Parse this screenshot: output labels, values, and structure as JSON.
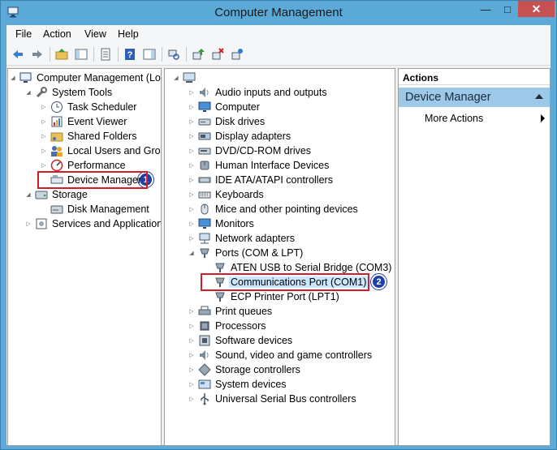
{
  "window": {
    "title": "Computer Management"
  },
  "menu": [
    "File",
    "Action",
    "View",
    "Help"
  ],
  "toolbar": [
    "back-icon",
    "forward-icon",
    "up-folder-icon",
    "show-hide-tree-icon",
    "export-list-icon",
    "help-icon",
    "show-hide-action-pane-icon",
    "scan-hardware-icon",
    "update-driver-icon",
    "uninstall-device-icon",
    "disable-device-icon"
  ],
  "left_tree": [
    {
      "label": "Computer Management (Local",
      "icon": "computer-management-icon",
      "indent": 0,
      "twisty": "expanded"
    },
    {
      "label": "System Tools",
      "icon": "tools-icon",
      "indent": 1,
      "twisty": "expanded"
    },
    {
      "label": "Task Scheduler",
      "icon": "clock-icon",
      "indent": 2,
      "twisty": "collapsed"
    },
    {
      "label": "Event Viewer",
      "icon": "event-viewer-icon",
      "indent": 2,
      "twisty": "collapsed"
    },
    {
      "label": "Shared Folders",
      "icon": "shared-folder-icon",
      "indent": 2,
      "twisty": "collapsed"
    },
    {
      "label": "Local Users and Groups",
      "icon": "users-icon",
      "indent": 2,
      "twisty": "collapsed"
    },
    {
      "label": "Performance",
      "icon": "performance-icon",
      "indent": 2,
      "twisty": "collapsed"
    },
    {
      "label": "Device Manager",
      "icon": "device-manager-icon",
      "indent": 2,
      "twisty": "none"
    },
    {
      "label": "Storage",
      "icon": "storage-icon",
      "indent": 1,
      "twisty": "expanded"
    },
    {
      "label": "Disk Management",
      "icon": "disk-icon",
      "indent": 2,
      "twisty": "none"
    },
    {
      "label": "Services and Applications",
      "icon": "services-icon",
      "indent": 1,
      "twisty": "collapsed"
    }
  ],
  "mid_root": {
    "label": "",
    "icon": "computer-icon"
  },
  "device_tree": [
    {
      "label": "Audio inputs and outputs",
      "icon": "speaker-icon",
      "indent": 1,
      "twisty": "collapsed"
    },
    {
      "label": "Computer",
      "icon": "monitor-icon",
      "indent": 1,
      "twisty": "collapsed"
    },
    {
      "label": "Disk drives",
      "icon": "disk-drive-icon",
      "indent": 1,
      "twisty": "collapsed"
    },
    {
      "label": "Display adapters",
      "icon": "display-adapter-icon",
      "indent": 1,
      "twisty": "collapsed"
    },
    {
      "label": "DVD/CD-ROM drives",
      "icon": "dvd-icon",
      "indent": 1,
      "twisty": "collapsed"
    },
    {
      "label": "Human Interface Devices",
      "icon": "hid-icon",
      "indent": 1,
      "twisty": "collapsed"
    },
    {
      "label": "IDE ATA/ATAPI controllers",
      "icon": "ide-icon",
      "indent": 1,
      "twisty": "collapsed"
    },
    {
      "label": "Keyboards",
      "icon": "keyboard-icon",
      "indent": 1,
      "twisty": "collapsed"
    },
    {
      "label": "Mice and other pointing devices",
      "icon": "mouse-icon",
      "indent": 1,
      "twisty": "collapsed"
    },
    {
      "label": "Monitors",
      "icon": "monitor-icon",
      "indent": 1,
      "twisty": "collapsed"
    },
    {
      "label": "Network adapters",
      "icon": "network-icon",
      "indent": 1,
      "twisty": "collapsed"
    },
    {
      "label": "Ports (COM & LPT)",
      "icon": "port-icon",
      "indent": 1,
      "twisty": "expanded"
    },
    {
      "label": "ATEN USB to Serial Bridge (COM3)",
      "icon": "port-icon",
      "indent": 2,
      "twisty": "none"
    },
    {
      "label": "Communications Port (COM1)",
      "icon": "port-icon",
      "indent": 2,
      "twisty": "none"
    },
    {
      "label": "ECP Printer Port (LPT1)",
      "icon": "port-icon",
      "indent": 2,
      "twisty": "none"
    },
    {
      "label": "Print queues",
      "icon": "printer-icon",
      "indent": 1,
      "twisty": "collapsed"
    },
    {
      "label": "Processors",
      "icon": "processor-icon",
      "indent": 1,
      "twisty": "collapsed"
    },
    {
      "label": "Software devices",
      "icon": "software-device-icon",
      "indent": 1,
      "twisty": "collapsed"
    },
    {
      "label": "Sound, video and game controllers",
      "icon": "speaker-icon",
      "indent": 1,
      "twisty": "collapsed"
    },
    {
      "label": "Storage controllers",
      "icon": "storage-controller-icon",
      "indent": 1,
      "twisty": "collapsed"
    },
    {
      "label": "System devices",
      "icon": "system-device-icon",
      "indent": 1,
      "twisty": "collapsed"
    },
    {
      "label": "Universal Serial Bus controllers",
      "icon": "usb-icon",
      "indent": 1,
      "twisty": "collapsed"
    }
  ],
  "callouts": {
    "first": "1",
    "second": "2"
  },
  "actions": {
    "header": "Actions",
    "section": "Device Manager",
    "more": "More Actions"
  },
  "colors": {
    "title_bar": "#5aa9d6",
    "close_button": "#c75050",
    "callout_border": "#d01f2a",
    "badge": "#1d3fa8",
    "actions_section": "#9ec8e8"
  }
}
